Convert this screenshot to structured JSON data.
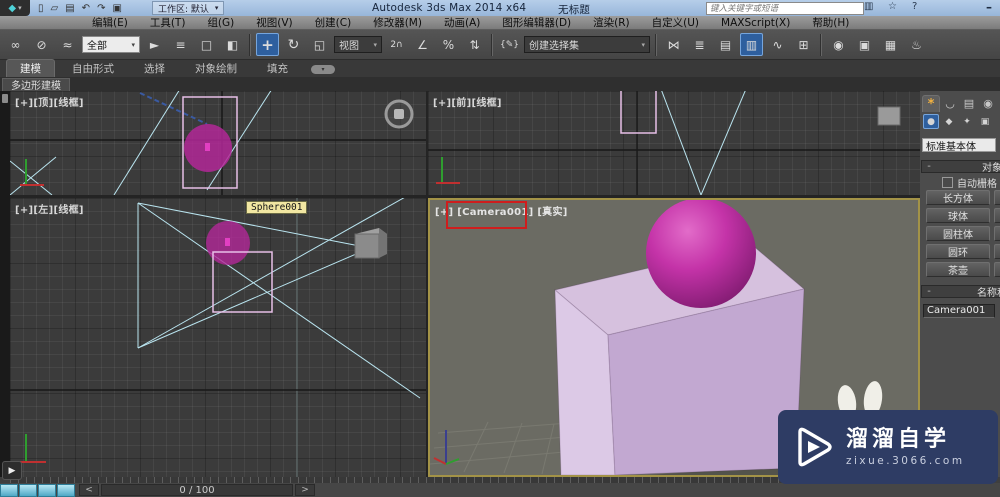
{
  "window": {
    "app_title": "Autodesk 3ds Max  2014 x64",
    "doc_title": "无标题",
    "logo_glyph": "◆",
    "logo_caret": "▾",
    "workspace": "工作区: 默认",
    "workspace_caret": "▾",
    "search_placeholder": "键入关键字或短语",
    "qat_icons": [
      {
        "name": "new-file",
        "glyph": "▯"
      },
      {
        "name": "open-file",
        "glyph": "▱"
      },
      {
        "name": "save-file",
        "glyph": "▤"
      },
      {
        "name": "undo",
        "glyph": "↶"
      },
      {
        "name": "redo",
        "glyph": "↷"
      },
      {
        "name": "project-folder",
        "glyph": "▣"
      }
    ],
    "info_icons": [
      {
        "name": "communication-center",
        "glyph": "▥"
      },
      {
        "name": "favorites",
        "glyph": "☆"
      },
      {
        "name": "help",
        "glyph": "?"
      }
    ],
    "minimize_glyph": "–"
  },
  "menu_bar": {
    "items": [
      "编辑(E)",
      "工具(T)",
      "组(G)",
      "视图(V)",
      "创建(C)",
      "修改器(M)",
      "动画(A)",
      "图形编辑器(D)",
      "渲染(R)",
      "自定义(U)",
      "MAXScript(X)",
      "帮助(H)"
    ]
  },
  "main_toolbar": {
    "filter_dropdown": "全部",
    "view_dropdown": "视图",
    "selection_set_dropdown": "创建选择集",
    "caret": "▾",
    "icons": [
      {
        "name": "select-and-link",
        "glyph": "∞"
      },
      {
        "name": "unlink-selection",
        "glyph": "⊘"
      },
      {
        "name": "bind-to-space-warp",
        "glyph": "≈"
      },
      {
        "name": "select-object",
        "glyph": "►"
      },
      {
        "name": "select-by-name",
        "glyph": "≡"
      },
      {
        "name": "rectangular-selection-region",
        "glyph": "□"
      },
      {
        "name": "window-crossing-toggle",
        "glyph": "◧"
      },
      {
        "name": "select-and-move",
        "glyph": "+",
        "active": true
      },
      {
        "name": "select-and-rotate",
        "glyph": "↻"
      },
      {
        "name": "select-and-scale",
        "glyph": "◱"
      },
      {
        "name": "snaps-toggle",
        "glyph": "2∩"
      },
      {
        "name": "angle-snap-toggle",
        "glyph": "∠"
      },
      {
        "name": "percent-snap-toggle",
        "glyph": "%"
      },
      {
        "name": "spinner-snap-toggle",
        "glyph": "⇅"
      },
      {
        "name": "edit-named-selection-sets",
        "glyph": "{✎}"
      },
      {
        "name": "mirror",
        "glyph": "⋈"
      },
      {
        "name": "align",
        "glyph": "≣"
      },
      {
        "name": "manage-layers",
        "glyph": "▤"
      },
      {
        "name": "graphite-ribbon-toggle",
        "glyph": "▥",
        "active": true
      },
      {
        "name": "curve-editor",
        "glyph": "∿"
      },
      {
        "name": "schematic-view",
        "glyph": "⊞"
      },
      {
        "name": "material-editor",
        "glyph": "◉"
      },
      {
        "name": "render-setup",
        "glyph": "▣"
      },
      {
        "name": "rendered-frame-window",
        "glyph": "▦"
      },
      {
        "name": "render-production",
        "glyph": "♨"
      }
    ]
  },
  "ribbon": {
    "tabs": [
      {
        "label": "建模",
        "active": true
      },
      {
        "label": "自由形式"
      },
      {
        "label": "选择"
      },
      {
        "label": "对象绘制"
      },
      {
        "label": "填充"
      }
    ],
    "pill_caret": "▾",
    "panel_tab": "多边形建模"
  },
  "viewports": {
    "top": {
      "label": "[+][顶][线框]"
    },
    "front": {
      "label": "[+][前][线框]"
    },
    "left": {
      "label": "[+][左][线框]",
      "tooltip": "Sphere001"
    },
    "camera": {
      "label_prefix": "[+]",
      "label_camera": "[Camera001]",
      "label_shading": "[真实]"
    }
  },
  "command_panel": {
    "tabs": [
      {
        "name": "create",
        "glyph": "*",
        "active": true
      },
      {
        "name": "modify",
        "glyph": "◡"
      },
      {
        "name": "hierarchy",
        "glyph": "▤"
      },
      {
        "name": "motion",
        "glyph": "◉"
      }
    ],
    "categories": [
      {
        "name": "geometry",
        "glyph": "●",
        "active": true
      },
      {
        "name": "shapes",
        "glyph": "◆"
      },
      {
        "name": "lights",
        "glyph": "✦"
      },
      {
        "name": "cameras",
        "glyph": "▣"
      }
    ],
    "subcategory_dropdown": "标准基本体",
    "object_type": {
      "collapse_glyph": "-",
      "title": "对象类型",
      "autogrid_label": "自动栅格",
      "buttons": [
        "长方体",
        "球体",
        "圆柱体",
        "圆环",
        "茶壶"
      ]
    },
    "name_color": {
      "collapse_glyph": "-",
      "title": "名称和颜色",
      "name_value": "Camera001"
    }
  },
  "timeline": {
    "frame_display": "0 / 100",
    "prev_glyph": "<",
    "next_glyph": ">",
    "expand_glyph": "▶"
  },
  "watermark": {
    "title": "溜溜自学",
    "url": "zixue.3066.com"
  },
  "colors": {
    "accent_blue": "#2e5f9e",
    "active_viewport_border": "#a39347",
    "sphere_magenta": "#bb2a9e",
    "box_lavender": "#d6c1de",
    "camera_label_highlight": "#cf1d1d",
    "watermark_navy": "#2e3c64"
  }
}
